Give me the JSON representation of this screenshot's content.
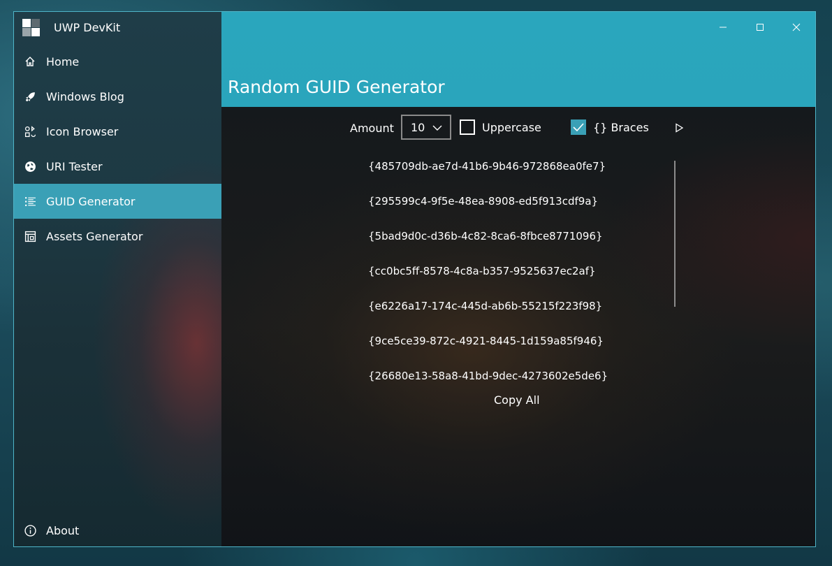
{
  "app": {
    "name": "UWP DevKit"
  },
  "nav": {
    "items": [
      {
        "label": "Home",
        "icon": "home-icon"
      },
      {
        "label": "Windows Blog",
        "icon": "rocket-icon"
      },
      {
        "label": "Icon Browser",
        "icon": "icons-grid-icon"
      },
      {
        "label": "URI Tester",
        "icon": "globe-icon"
      },
      {
        "label": "GUID Generator",
        "icon": "list-icon",
        "selected": true
      },
      {
        "label": "Assets Generator",
        "icon": "assets-icon"
      }
    ],
    "about": {
      "label": "About",
      "icon": "info-icon"
    }
  },
  "header": {
    "title": "Random GUID Generator"
  },
  "toolbar": {
    "amount_label": "Amount",
    "amount_value": "10",
    "uppercase_label": "Uppercase",
    "uppercase_checked": false,
    "braces_label": "{} Braces",
    "braces_checked": true
  },
  "guids": [
    "{485709db-ae7d-41b6-9b46-972868ea0fe7}",
    "{295599c4-9f5e-48ea-8908-ed5f913cdf9a}",
    "{5bad9d0c-d36b-4c82-8ca6-8fbce8771096}",
    "{cc0bc5ff-8578-4c8a-b357-9525637ec2af}",
    "{e6226a17-174c-445d-ab6b-55215f223f98}",
    "{9ce5ce39-872c-4921-8445-1d159a85f946}",
    "{26680e13-58a8-41bd-9dec-4273602e5de6}"
  ],
  "copy_all_label": "Copy All",
  "colors": {
    "accent": "#3aa0b6",
    "header": "#2aa6bd",
    "text": "#ffffff"
  }
}
